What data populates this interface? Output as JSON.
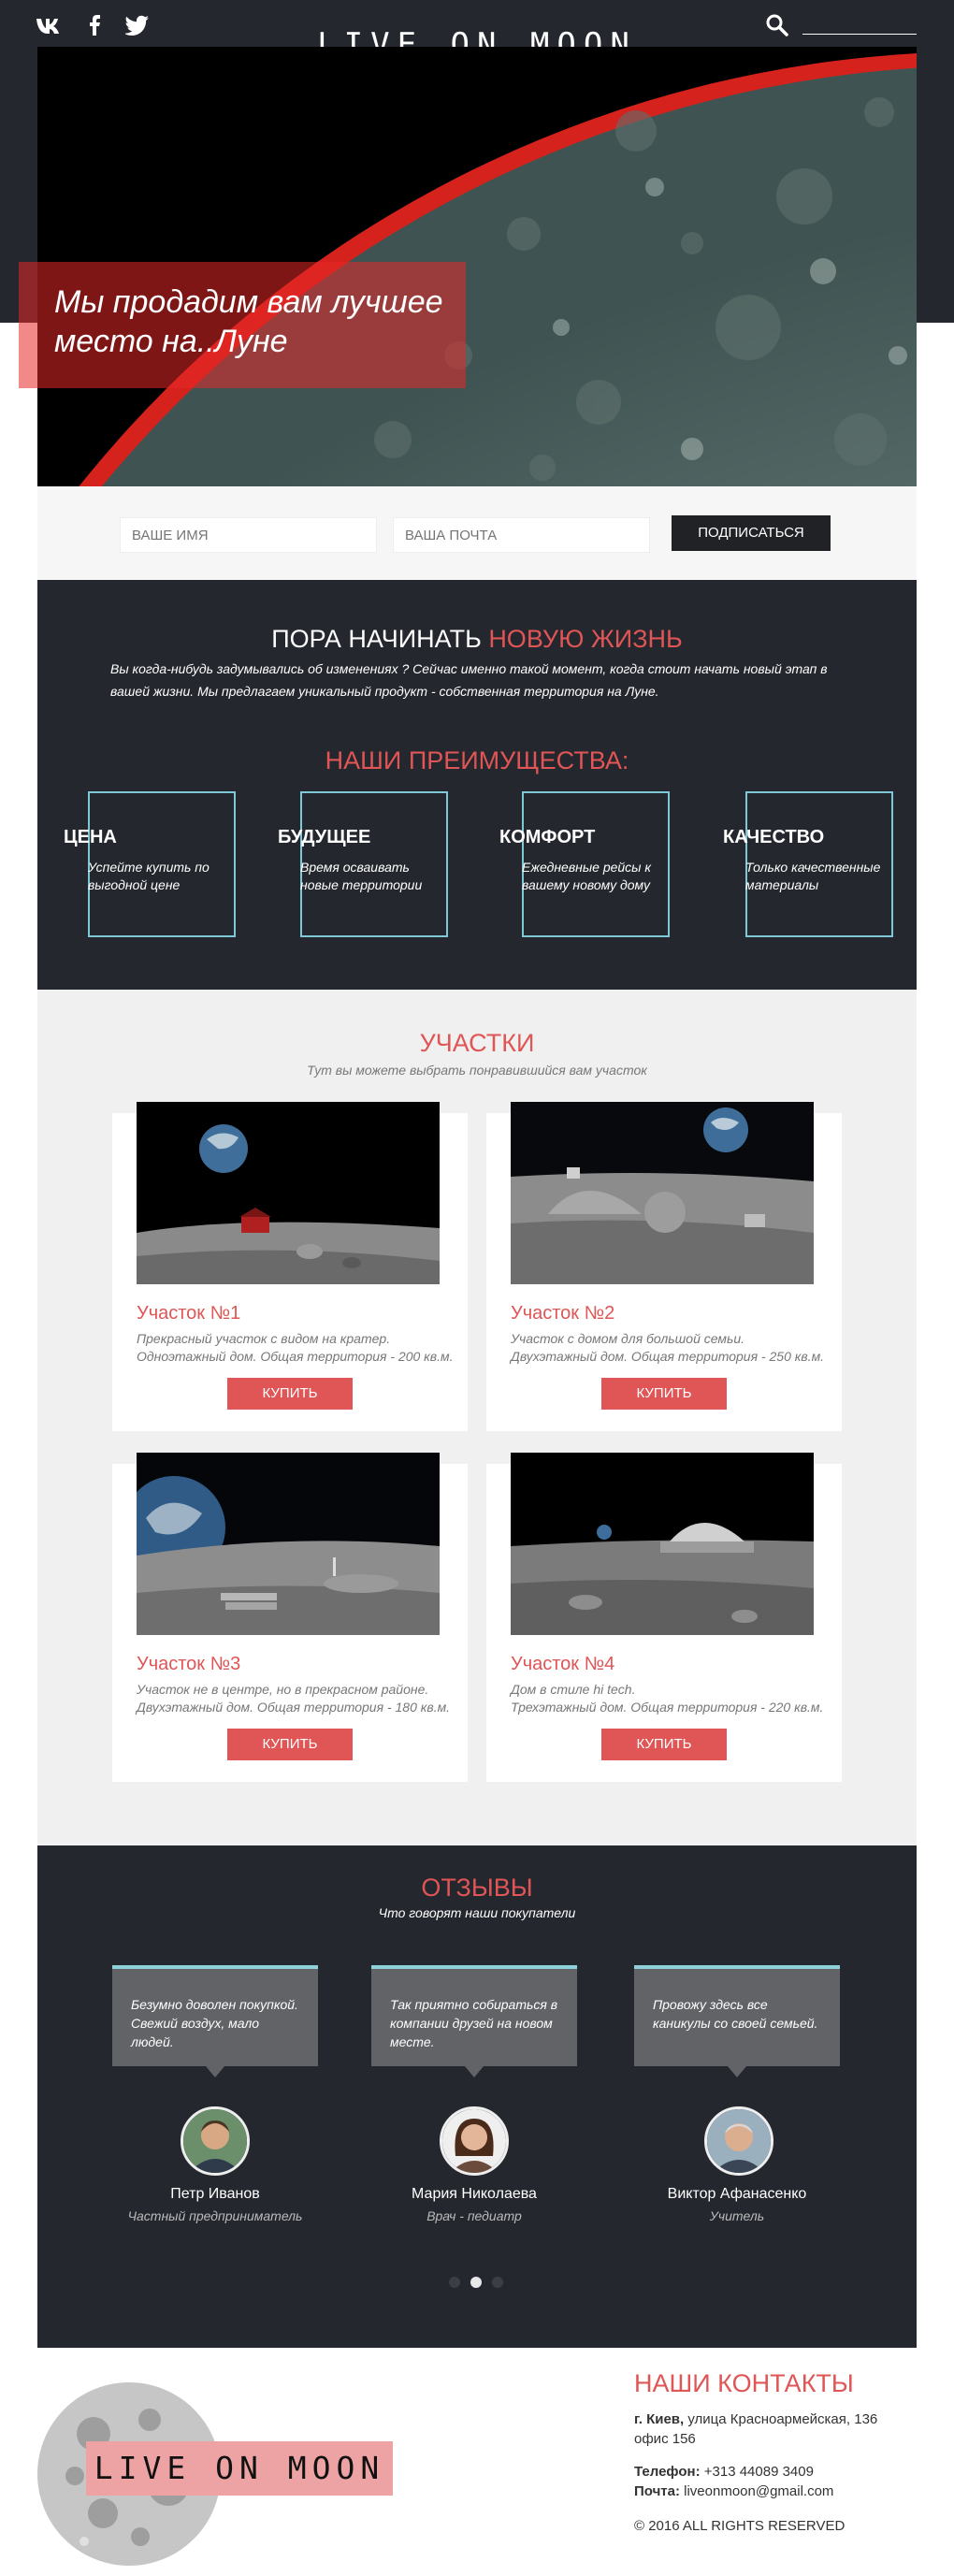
{
  "header": {
    "logo": "LIVE ON MOON",
    "social": [
      {
        "name": "vk-icon",
        "label": "VK"
      },
      {
        "name": "facebook-icon",
        "label": "f"
      },
      {
        "name": "twitter-icon",
        "label": "twitter"
      }
    ],
    "search_icon": "search-icon"
  },
  "hero": {
    "headline": "Мы продадим вам лучшее место на..Луне"
  },
  "subscribe": {
    "name_placeholder": "ВАШЕ ИМЯ",
    "email_placeholder": "ВАША ПОЧТА",
    "button": "ПОДПИСАТЬСЯ"
  },
  "about": {
    "title_part1": "ПОРА НАЧИНАТЬ",
    "title_part2": "НОВУЮ ЖИЗНЬ",
    "text": "Вы когда-нибудь задумывались об изменениях ? Сейчас именно такой момент, когда  стоит начать новый этап в вашей жизни. Мы предлагаем уникальный продукт  - собственная территория на Луне.",
    "adv_title": "НАШИ ПРЕИМУЩЕСТВА:",
    "advantages": [
      {
        "name": "ЦЕНА",
        "desc": "Успейте купить по выгодной цене"
      },
      {
        "name": "БУДУЩЕЕ",
        "desc": "Время осваивать новые территории"
      },
      {
        "name": "КОМФОРТ",
        "desc": "Ежедневные рейсы к вашему новому дому"
      },
      {
        "name": "КАЧЕСТВО",
        "desc": "Только качественные материалы"
      }
    ]
  },
  "plots": {
    "title": "УЧАСТКИ",
    "subtitle": "Тут вы можете выбрать понравившийся вам участок",
    "buy_label": "КУПИТЬ",
    "items": [
      {
        "title": "Участок №1",
        "desc1": "Прекрасный участок с видом на кратер.",
        "desc2": "Одноэтажный дом. Общая территория - 200 кв.м."
      },
      {
        "title": "Участок №2",
        "desc1": "Участок с домом для большой семьи.",
        "desc2": "Двухэтажный дом. Общая территория - 250 кв.м."
      },
      {
        "title": "Участок №3",
        "desc1": "Участок не в центре, но в прекрасном районе.",
        "desc2": "Двухэтажный дом. Общая территория - 180 кв.м."
      },
      {
        "title": "Участок №4",
        "desc1": "Дом в стиле hi tech.",
        "desc2": "Трехэтажный дом. Общая территория - 220 кв.м."
      }
    ]
  },
  "reviews": {
    "title": "ОТЗЫВЫ",
    "subtitle": "Что говорят наши покупатели",
    "items": [
      {
        "quote": "Безумно доволен покупкой. Свежий воздух, мало людей.",
        "name": "Петр Иванов",
        "role": "Частный предприниматель"
      },
      {
        "quote": "Так приятно собираться  в компании друзей на новом месте.",
        "name": "Мария Николаева",
        "role": "Врач - педиатр"
      },
      {
        "quote": "Провожу здесь все каникулы со своей семьей.",
        "name": "Виктор Афанасенко",
        "role": "Учитель"
      }
    ]
  },
  "footer": {
    "logo": "LIVE ON MOON",
    "contacts_title": "НАШИ КОНТАКТЫ",
    "address_city": "г. Киев,",
    "address_rest": " улица Красноармейская, 136",
    "address_office": "офис 156",
    "phone_label": "Телефон:",
    "phone": " +313 44089 3409",
    "mail_label": "Почта:",
    "mail": " liveonmoon@gmail.com",
    "copyright": "© 2016 ALL RIGHTS RESERVED"
  },
  "colors": {
    "accent": "#e05555",
    "dark": "#24272e",
    "border_cyan": "#7fc8d6"
  }
}
